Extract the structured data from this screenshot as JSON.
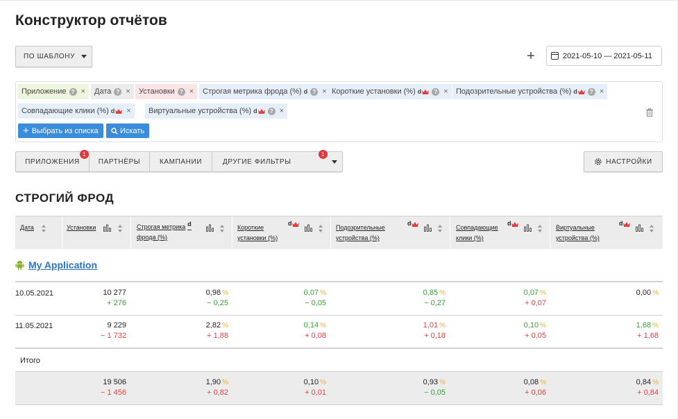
{
  "page_title": "Конструктор отчётов",
  "template_button": "по шаблону",
  "date_range": "2021-05-10 — 2021-05-11",
  "filter_tags": [
    {
      "label": "Приложение",
      "d": "",
      "crown": false
    },
    {
      "label": "Дата",
      "d": "",
      "crown": false
    },
    {
      "label": "Установки",
      "d": "",
      "crown": false
    },
    {
      "label": "Строгая метрика фрода (%)",
      "d": "d",
      "crown": false
    },
    {
      "label": "Короткие установки (%)",
      "d": "d",
      "crown": true
    },
    {
      "label": "Подозрительные устройства (%)",
      "d": "d",
      "crown": true
    },
    {
      "label": "Совпадающие клики (%)",
      "d": "d",
      "crown": true
    },
    {
      "label": "Виртуальные устройства (%)",
      "d": "d",
      "crown": true
    }
  ],
  "select_from_list": "Выбрать из списка",
  "search_button": "Искать",
  "nav_tabs": [
    {
      "label": "приложения",
      "badge": "1"
    },
    {
      "label": "партнёры",
      "badge": ""
    },
    {
      "label": "кампании",
      "badge": ""
    },
    {
      "label": "другие фильтры",
      "badge": "1"
    }
  ],
  "settings_button": "настройки",
  "section_title": "СТРОГИЙ ФРОД",
  "columns": [
    {
      "line1": "Дата",
      "line2": ""
    },
    {
      "line1": "Установки",
      "line2": ""
    },
    {
      "line1": "Строгая метрика",
      "line2": "фрода (%)",
      "d": "d"
    },
    {
      "line1": "Короткие",
      "line2": "установки (%)",
      "d": "d"
    },
    {
      "line1": "Подозрительные",
      "line2": "устройства (%)",
      "d": "d"
    },
    {
      "line1": "Совпадающие",
      "line2": "клики (%)",
      "d": "d"
    },
    {
      "line1": "Виртуальные",
      "line2": "устройства (%)",
      "d": "d"
    }
  ],
  "app_name": "My Application",
  "rows": [
    {
      "date": "10.05.2021",
      "installs": {
        "value": "10 277",
        "delta": "+ 276",
        "dir": "up"
      },
      "strict": {
        "value": "0,98",
        "delta": "− 0,25",
        "dir": "up",
        "pct": "yellow"
      },
      "short": {
        "value": "0,07",
        "delta": "− 0,05",
        "dir": "up",
        "pct": "yellow",
        "color": "green"
      },
      "suspicious": {
        "value": "0,85",
        "delta": "− 0,27",
        "dir": "up",
        "pct": "yellow",
        "color": "green"
      },
      "matching": {
        "value": "0,07",
        "delta": "+ 0,07",
        "dir": "down",
        "pct": "yellow",
        "color": "green"
      },
      "virtual": {
        "value": "0,00",
        "delta": "",
        "dir": "up",
        "pct": "yellow"
      }
    },
    {
      "date": "11.05.2021",
      "installs": {
        "value": "9 229",
        "delta": "− 1 732",
        "dir": "down"
      },
      "strict": {
        "value": "2,82",
        "delta": "+ 1,88",
        "dir": "down",
        "pct": "yellow"
      },
      "short": {
        "value": "0,14",
        "delta": "+ 0,08",
        "dir": "down",
        "pct": "yellow",
        "color": "green"
      },
      "suspicious": {
        "value": "1,01",
        "delta": "+ 0,18",
        "dir": "down",
        "pct": "yellow",
        "color": "red"
      },
      "matching": {
        "value": "0,10",
        "delta": "+ 0,05",
        "dir": "down",
        "pct": "yellow",
        "color": "green"
      },
      "virtual": {
        "value": "1,68",
        "delta": "+ 1,68",
        "dir": "down",
        "pct": "yellow",
        "color": "green"
      }
    }
  ],
  "total_label": "Итого",
  "totals": {
    "installs": {
      "value": "19 506",
      "delta": "− 1 456"
    },
    "strict": {
      "value": "1,90",
      "delta": "+ 0,82"
    },
    "short": {
      "value": "0,10",
      "delta": "+ 0,01"
    },
    "suspicious": {
      "value": "0,93",
      "delta": "− 0,05"
    },
    "matching": {
      "value": "0,08",
      "delta": "+ 0,06"
    },
    "virtual": {
      "value": "0,84",
      "delta": "+ 0,84"
    }
  },
  "percent_sign": "%",
  "colors": {
    "accent": "#3b8ddb",
    "link": "#2a74c5",
    "up": "#35a036",
    "down": "#e53d3d",
    "pct": "#e3b33a",
    "badge": "#e0393e"
  }
}
